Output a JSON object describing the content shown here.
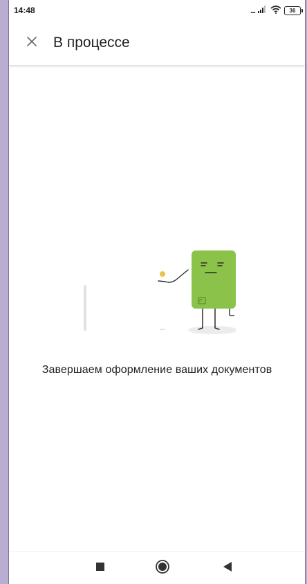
{
  "status_bar": {
    "time": "14:48",
    "signal_text": "...",
    "battery_level": "36",
    "icons": [
      "signal-icon",
      "wifi-icon",
      "battery-icon"
    ]
  },
  "app_bar": {
    "title": "В процессе",
    "close_icon": "close-icon"
  },
  "main": {
    "message": "Завершаем оформление ваших документов",
    "illustration": "green-card-character-illustration"
  },
  "nav_bar": {
    "icons": [
      "recent-apps-icon",
      "home-icon",
      "back-icon"
    ]
  },
  "colors": {
    "outer_background": "#b9aed2",
    "card_green": "#8bc34a",
    "coin_yellow": "#e8c24a",
    "text_primary": "#1f1f1f"
  }
}
